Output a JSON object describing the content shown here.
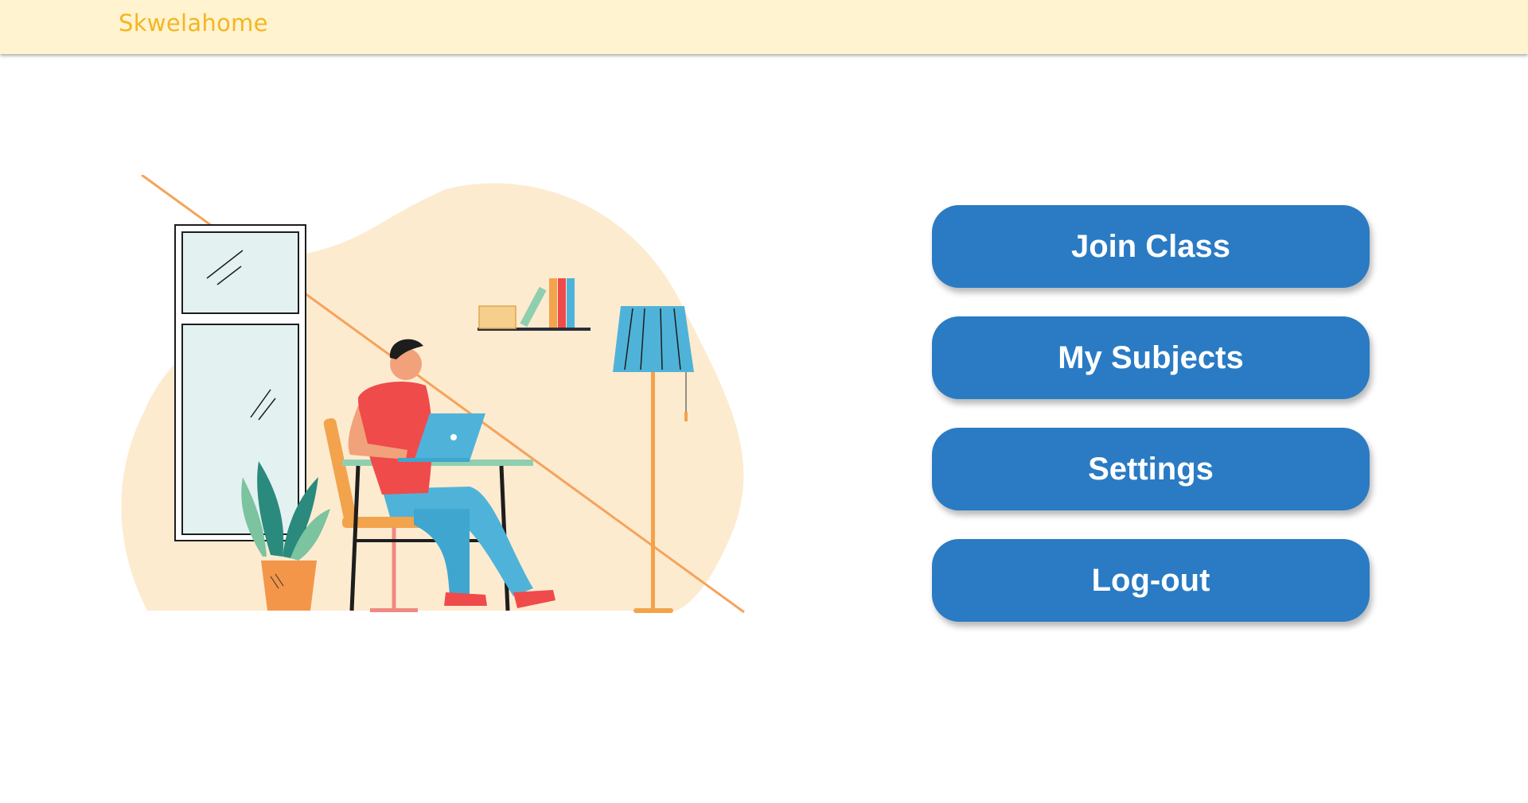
{
  "app": {
    "brand": "Skwelahome"
  },
  "menu": {
    "items": [
      {
        "label": "Join Class"
      },
      {
        "label": "My Subjects"
      },
      {
        "label": "Settings"
      },
      {
        "label": "Log-out"
      }
    ]
  },
  "colors": {
    "header_bg": "#fff3d0",
    "brand": "#f5b522",
    "button_bg": "#2a7bc3",
    "button_text": "#ffffff",
    "blob": "#fdebd0"
  },
  "illustration": {
    "icon": "person-studying-at-laptop-illustration"
  }
}
